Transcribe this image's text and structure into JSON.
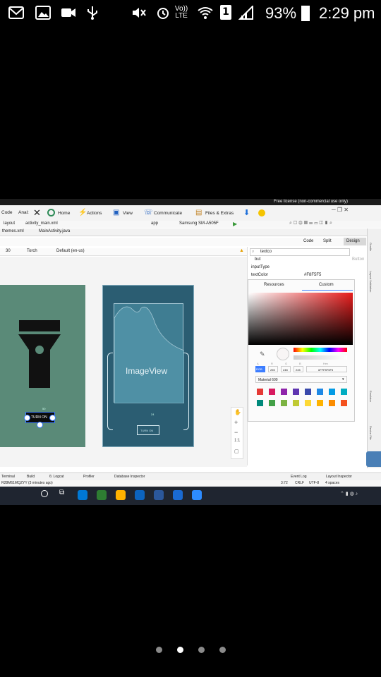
{
  "status_bar": {
    "battery": "93%",
    "time": "2:29 pm",
    "sim": "1",
    "volte": "Vo)) LTE"
  },
  "teamviewer": {
    "license": "Free license (non-commercial use only)",
    "code_label": "Code",
    "anal_label": "Anal:",
    "home": "Home",
    "actions": "Actions",
    "view": "View",
    "communicate": "Communicate",
    "files": "Files & Extras"
  },
  "ide": {
    "breadcrumb_layout": "layout",
    "breadcrumb_file": "activity_main.xml",
    "device_dropdown": "app",
    "device_name": "Samsung SM-A505F",
    "tabs": [
      "themes.xml",
      "MainActivity.java"
    ],
    "view_modes": {
      "code": "Code",
      "split": "Split",
      "design": "Design"
    },
    "toolbar": {
      "api": "30",
      "theme": "Torch",
      "locale": "Default (en-us)"
    },
    "imageview_label": "ImageView",
    "button_label": "TURN ON",
    "button_label_blueprint": "TURN ON",
    "constraint_50": "50",
    "constraint_24": "24"
  },
  "attributes": {
    "search_value": "textco",
    "but": "but",
    "button_hint": "Button",
    "input_type": "inputType",
    "text_color": "textColor",
    "text_color_value": "#F8F5F5",
    "tab_resources": "Resources",
    "tab_custom": "Custom",
    "color_fields": {
      "a_label": "A",
      "r_label": "R",
      "g_label": "G",
      "b_label": "B",
      "hex_label": "Hex",
      "mode": "RGB",
      "a": "255",
      "r": "248",
      "g": "245",
      "b": "245",
      "hex": "#FFF8F5F5"
    },
    "palette_name": "Material 600",
    "palette_row1": [
      "#e53935",
      "#d81b60",
      "#8e24aa",
      "#5e35b1",
      "#3949ab",
      "#1e88e5",
      "#039be5",
      "#00acc1"
    ],
    "palette_row2": [
      "#00897b",
      "#43a047",
      "#7cb342",
      "#c0ca33",
      "#fdd835",
      "#ffb300",
      "#fb8c00",
      "#f4511e"
    ]
  },
  "side_labels": [
    "Gradle",
    "Layout Validation",
    "Emulator",
    "Device File"
  ],
  "bottom_bar": {
    "tabs": [
      "Terminal",
      "Build",
      "6: Logcat",
      "Profiler",
      "Database Inspector"
    ],
    "right_tabs": [
      "Event Log",
      "Layout Inspector"
    ],
    "status_text": "R28M61MQZYY (3 minutes ago)",
    "cursor": "3:72",
    "line_sep": "CRLF",
    "encoding": "UTF-8",
    "indent": "4 spaces"
  },
  "taskbar_colors": [
    "#0078d4",
    "#2e7d32",
    "#ffb300",
    "#0c64c0",
    "#2b579a",
    "#1a6ad1",
    "#2d8cff"
  ],
  "pager": {
    "count": 4,
    "active": 1
  }
}
